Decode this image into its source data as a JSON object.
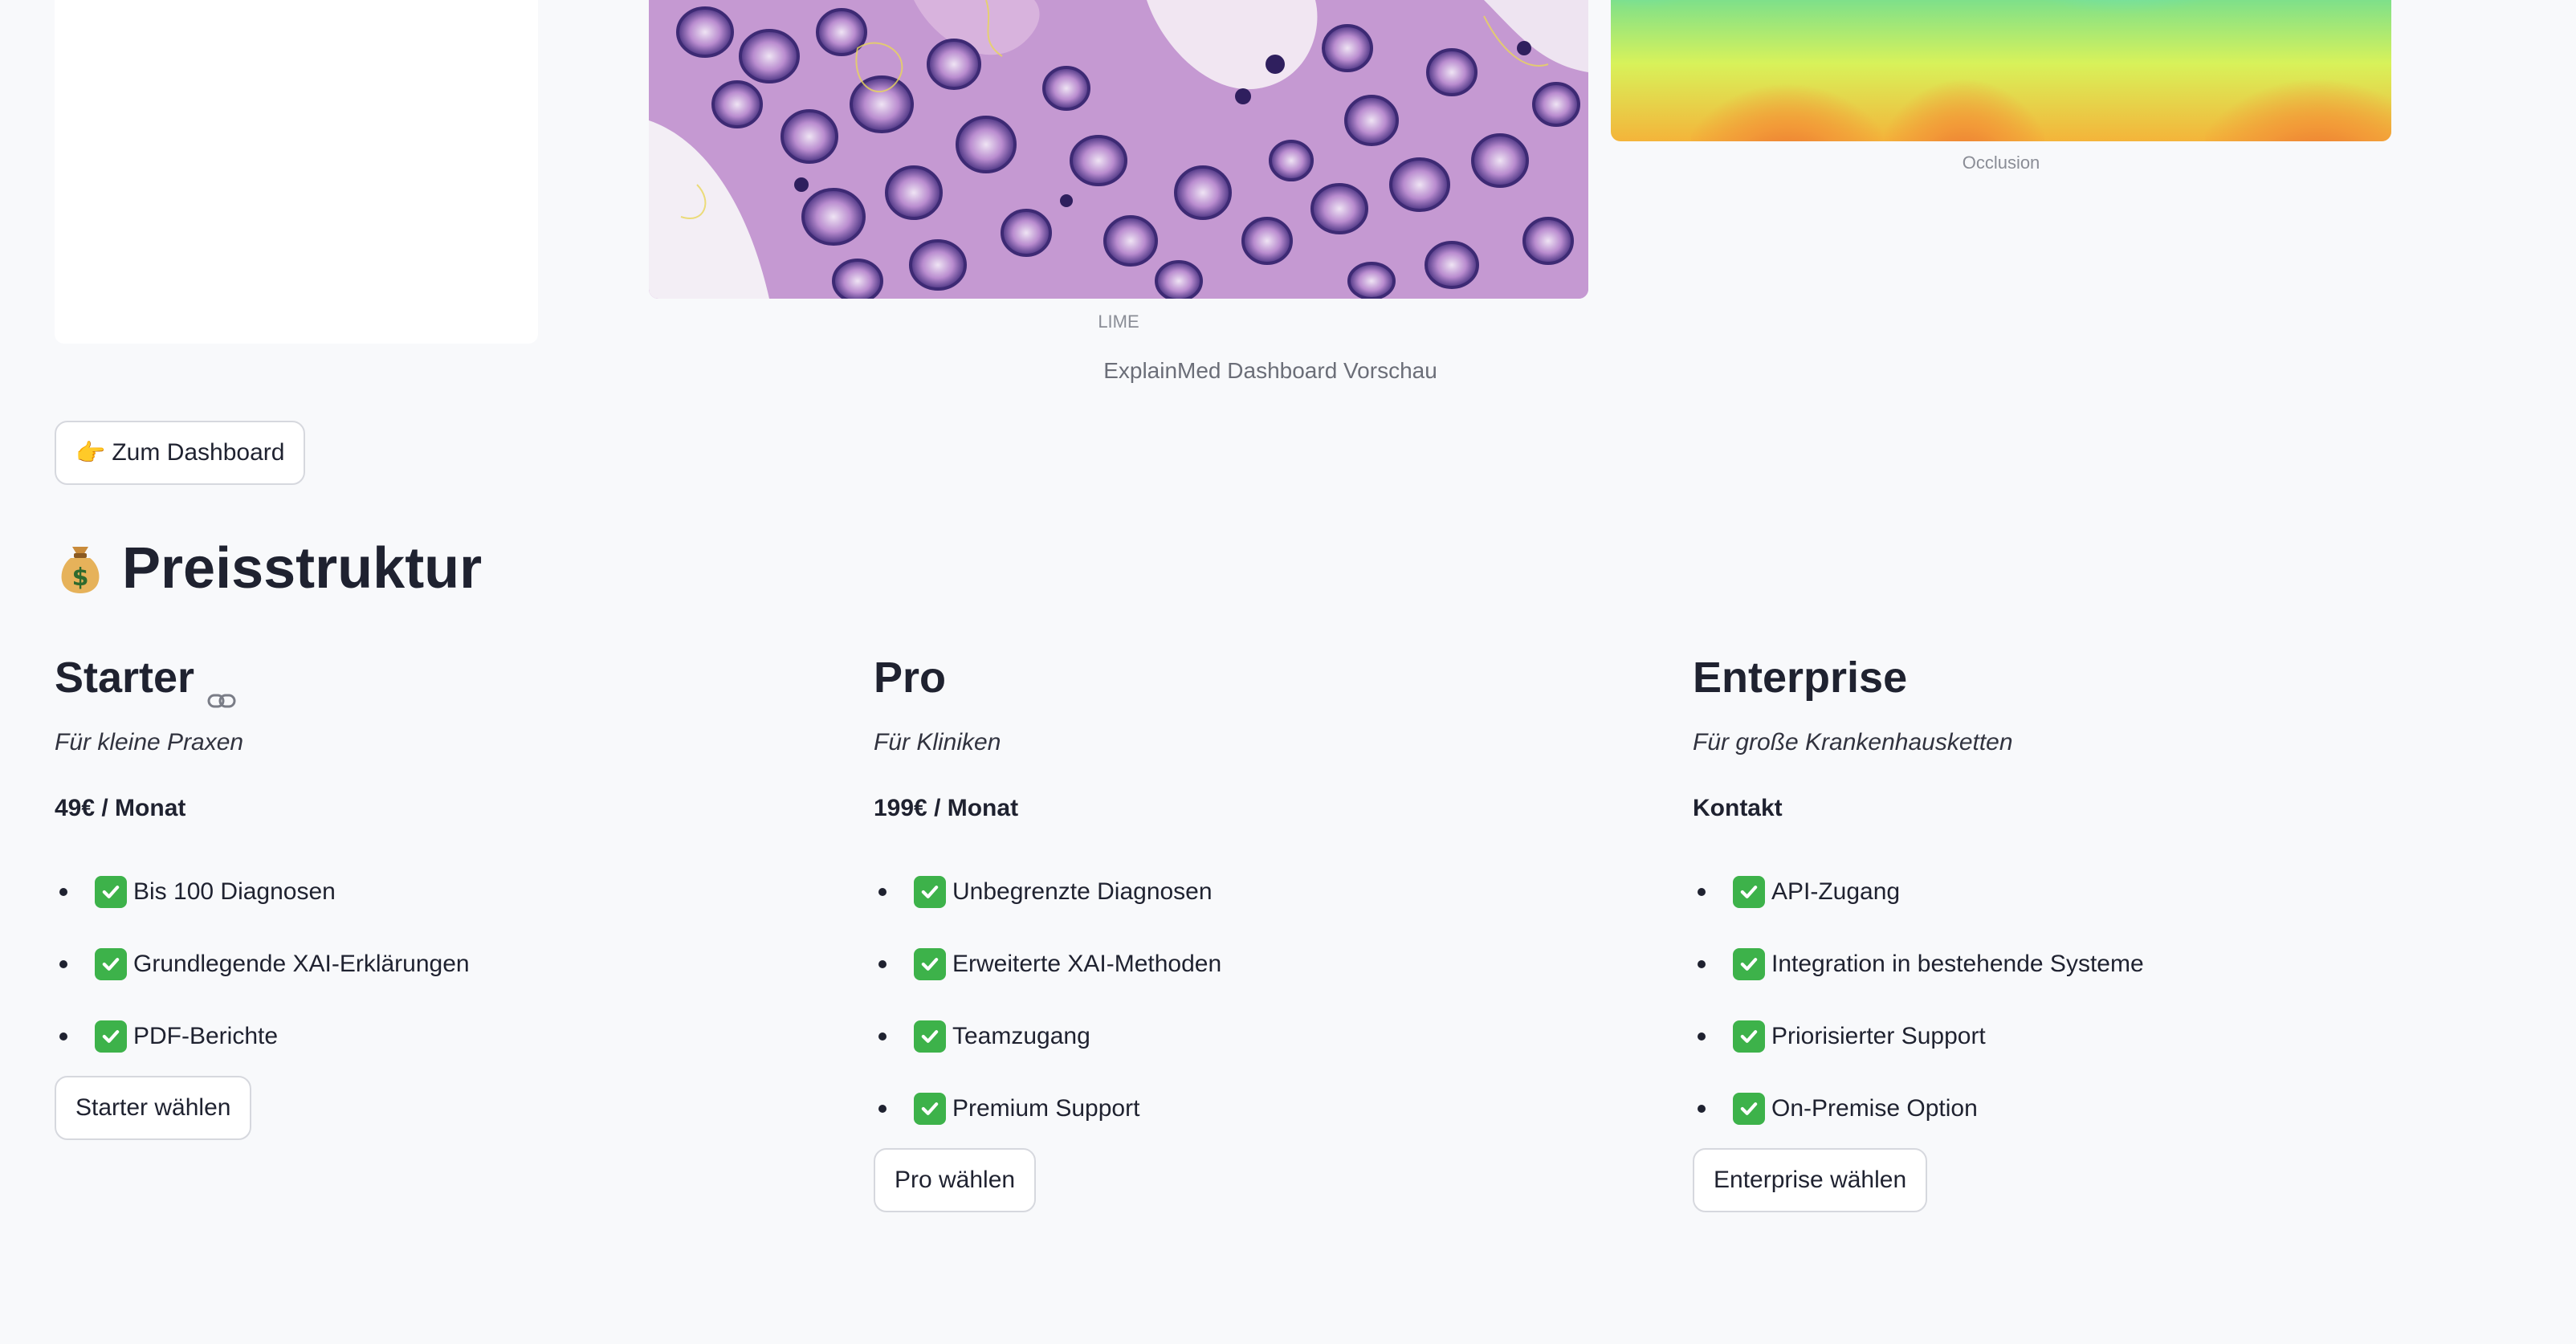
{
  "preview": {
    "lime_caption": "LIME",
    "occlusion_caption": "Occlusion",
    "main_caption": "ExplainMed Dashboard Vorschau"
  },
  "dashboard_button": {
    "icon": "pointing-hand-icon",
    "label": "Zum Dashboard"
  },
  "pricing": {
    "title": "Preisstruktur",
    "title_icon": "money-bag-icon",
    "plans": [
      {
        "name": "Starter",
        "subtitle": "Für kleine Praxen",
        "price": "49€ / Monat",
        "features": [
          "Bis 100 Diagnosen",
          "Grundlegende XAI-Erklärungen",
          "PDF-Berichte"
        ],
        "button": "Starter wählen"
      },
      {
        "name": "Pro",
        "subtitle": "Für Kliniken",
        "price": "199€ / Monat",
        "features": [
          "Unbegrenzte Diagnosen",
          "Erweiterte XAI-Methoden",
          "Teamzugang",
          "Premium Support"
        ],
        "button": "Pro wählen"
      },
      {
        "name": "Enterprise",
        "subtitle": "Für große Krankenhausketten",
        "price": "Kontakt",
        "features": [
          "API-Zugang",
          "Integration in bestehende Systeme",
          "Priorisierter Support",
          "On-Premise Option"
        ],
        "button": "Enterprise wählen"
      }
    ]
  },
  "colors": {
    "background": "#f8f9fb",
    "check_green": "#3db24a",
    "text_dark": "#1f2230"
  }
}
